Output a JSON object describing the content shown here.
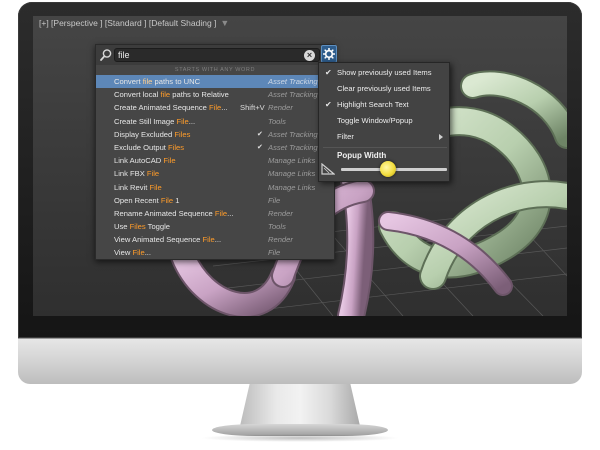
{
  "viewport": {
    "label": "[+] [Perspective ] [Standard ] [Default Shading ]",
    "filter_icon": "funnel-icon"
  },
  "search": {
    "query": "file",
    "search_icon": "search-icon",
    "clear_icon": "clear-icon",
    "options_icon": "gear-icon",
    "section_header": "STARTS WITH ANY WORD"
  },
  "results": [
    {
      "pre": "Convert ",
      "hl": "file",
      "post": " paths to UNC",
      "shortcut": "",
      "checked": "",
      "category": "Asset Tracking"
    },
    {
      "pre": "Convert local ",
      "hl": "file",
      "post": " paths to Relative",
      "shortcut": "",
      "checked": "",
      "category": "Asset Tracking"
    },
    {
      "pre": "Create Animated Sequence ",
      "hl": "File",
      "post": "...",
      "shortcut": "Shift+V",
      "checked": "",
      "category": "Render"
    },
    {
      "pre": "Create Still Image ",
      "hl": "File",
      "post": "...",
      "shortcut": "",
      "checked": "",
      "category": "Tools"
    },
    {
      "pre": "Display Excluded ",
      "hl": "Files",
      "post": "",
      "shortcut": "",
      "checked": "✔",
      "category": "Asset Tracking"
    },
    {
      "pre": "Exclude Output ",
      "hl": "Files",
      "post": "",
      "shortcut": "",
      "checked": "✔",
      "category": "Asset Tracking"
    },
    {
      "pre": "Link AutoCAD ",
      "hl": "File",
      "post": "",
      "shortcut": "",
      "checked": "",
      "category": "Manage Links"
    },
    {
      "pre": "Link FBX ",
      "hl": "File",
      "post": "",
      "shortcut": "",
      "checked": "",
      "category": "Manage Links"
    },
    {
      "pre": "Link Revit ",
      "hl": "File",
      "post": "",
      "shortcut": "",
      "checked": "",
      "category": "Manage Links"
    },
    {
      "pre": "Open Recent ",
      "hl": "File",
      "post": " 1",
      "shortcut": "",
      "checked": "",
      "category": "File"
    },
    {
      "pre": "Rename Animated Sequence ",
      "hl": "File",
      "post": "...",
      "shortcut": "",
      "checked": "",
      "category": "Render"
    },
    {
      "pre": "Use ",
      "hl": "Files",
      "post": " Toggle",
      "shortcut": "",
      "checked": "",
      "category": "Tools"
    },
    {
      "pre": "View Animated Sequence ",
      "hl": "File",
      "post": "...",
      "shortcut": "",
      "checked": "",
      "category": "Render"
    },
    {
      "pre": "View ",
      "hl": "File",
      "post": "...",
      "shortcut": "",
      "checked": "",
      "category": "File"
    }
  ],
  "options_menu": {
    "items": [
      {
        "label": "Show previously used Items",
        "checked": "✔"
      },
      {
        "label": "Clear previously used Items",
        "checked": ""
      },
      {
        "label": "Highlight Search Text",
        "checked": "✔"
      },
      {
        "label": "Toggle Window/Popup",
        "checked": ""
      },
      {
        "label": "Filter",
        "checked": ""
      }
    ],
    "width_title": "Popup Width",
    "width_value": 0.44
  },
  "colors": {
    "highlight": "#ff9c2a",
    "selection": "#5d87b8",
    "tube_pink": "#c9a3c4",
    "tube_green": "#b8cfae"
  }
}
